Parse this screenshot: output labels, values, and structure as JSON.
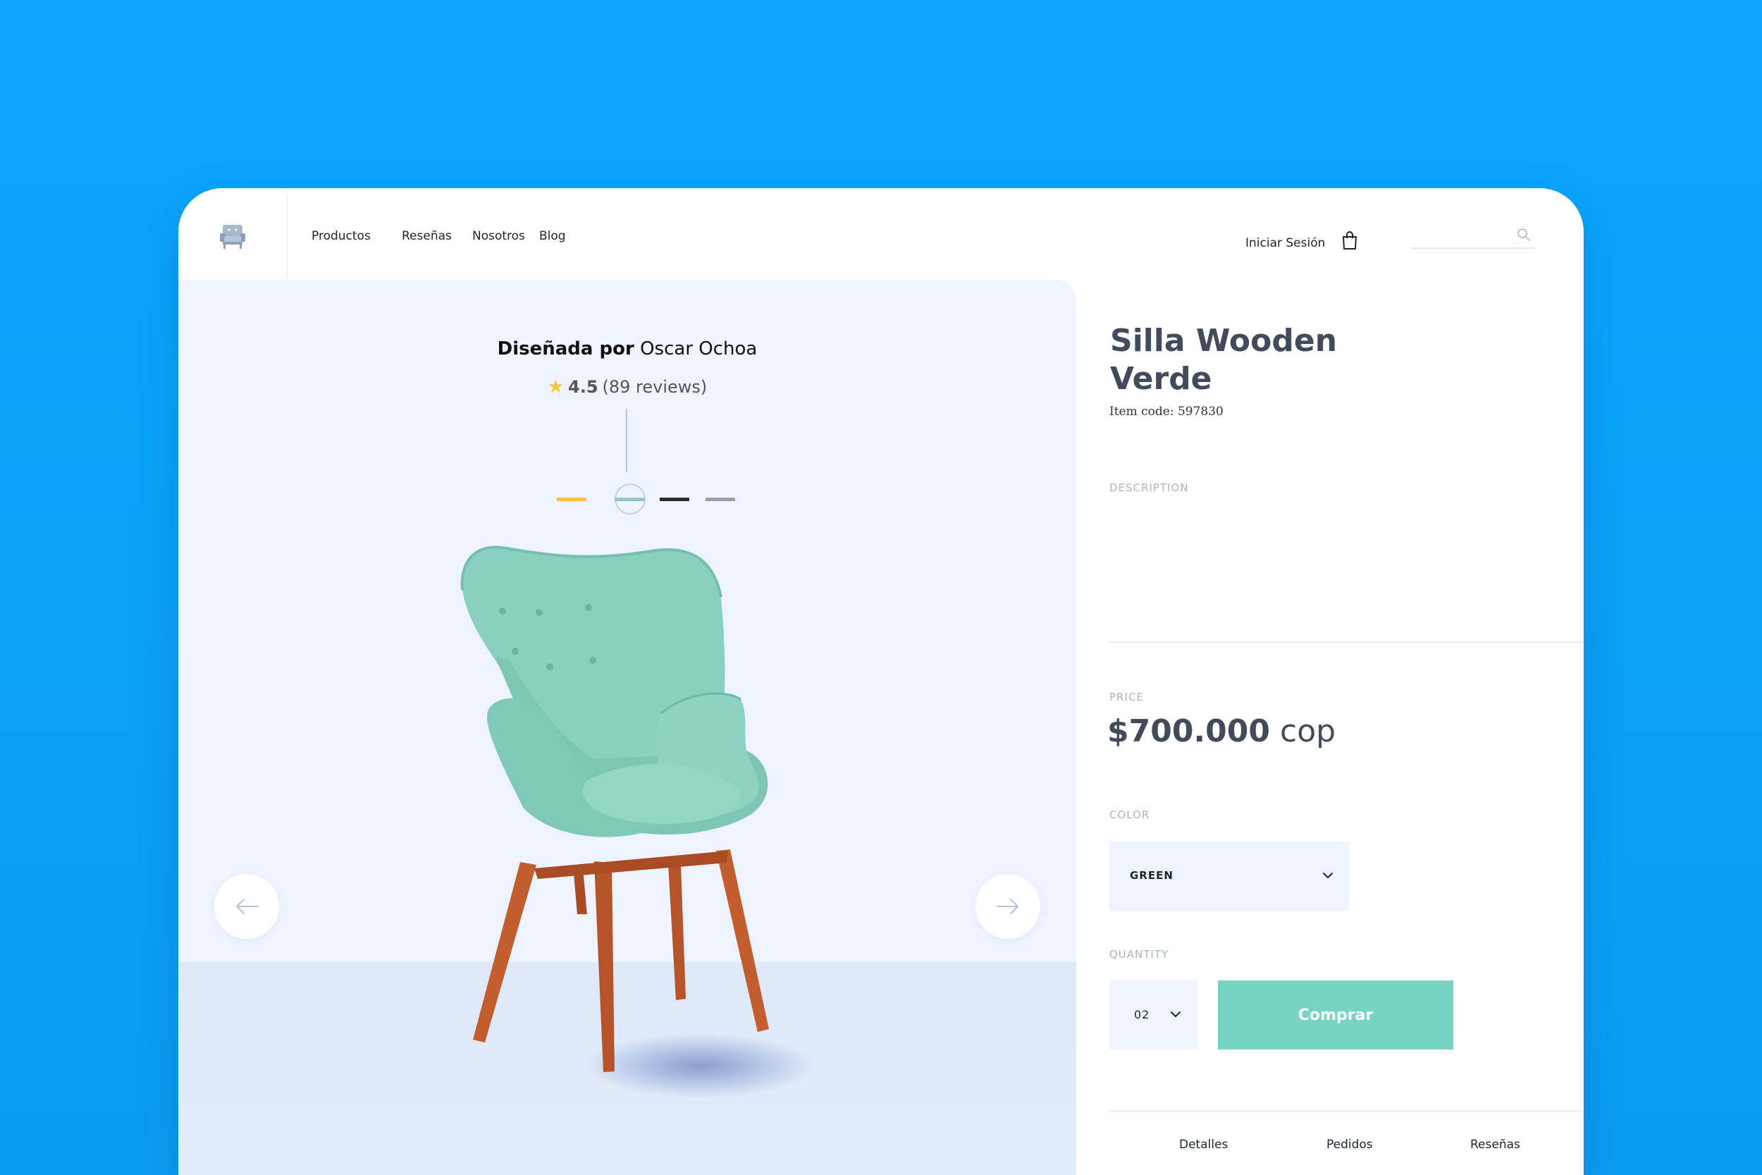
{
  "nav": {
    "items": [
      {
        "label": "Productos"
      },
      {
        "label": "Reseñas"
      },
      {
        "label": "Nosotros"
      },
      {
        "label": "Blog"
      }
    ],
    "login_label": "Iniciar Sesión",
    "search_placeholder": ""
  },
  "gallery": {
    "designer_prefix": "Diseñada por",
    "designer_name": "Oscar Ochoa",
    "rating": "4.5",
    "reviews": "(89 reviews)",
    "swatches": [
      {
        "color": "#f6c243",
        "name": "yellow"
      },
      {
        "color": "#8fc9bc",
        "name": "green",
        "selected": true
      },
      {
        "color": "#2a2d33",
        "name": "black"
      },
      {
        "color": "#9aa0a8",
        "name": "gray"
      }
    ]
  },
  "product": {
    "title_light": "Silla",
    "title_bold": "Wooden",
    "title_line2": "Verde",
    "item_code": "Item code: 597830",
    "description_label": "DESCRIPTION",
    "price_label": "PRICE",
    "price_amount": "$700.000",
    "price_currency": "cop",
    "color_label": "COLOR",
    "color_value": "GREEN",
    "quantity_label": "QUANTITY",
    "quantity_value": "02",
    "buy_label": "Comprar"
  },
  "tabs": [
    {
      "label": "Detalles"
    },
    {
      "label": "Pedidos"
    },
    {
      "label": "Reseñas"
    }
  ],
  "colors": {
    "background": "#0aa3fb",
    "accent": "#77d4c1",
    "panel": "#eef4fd",
    "text_dark": "#424b5a",
    "star": "#f5c73d"
  }
}
